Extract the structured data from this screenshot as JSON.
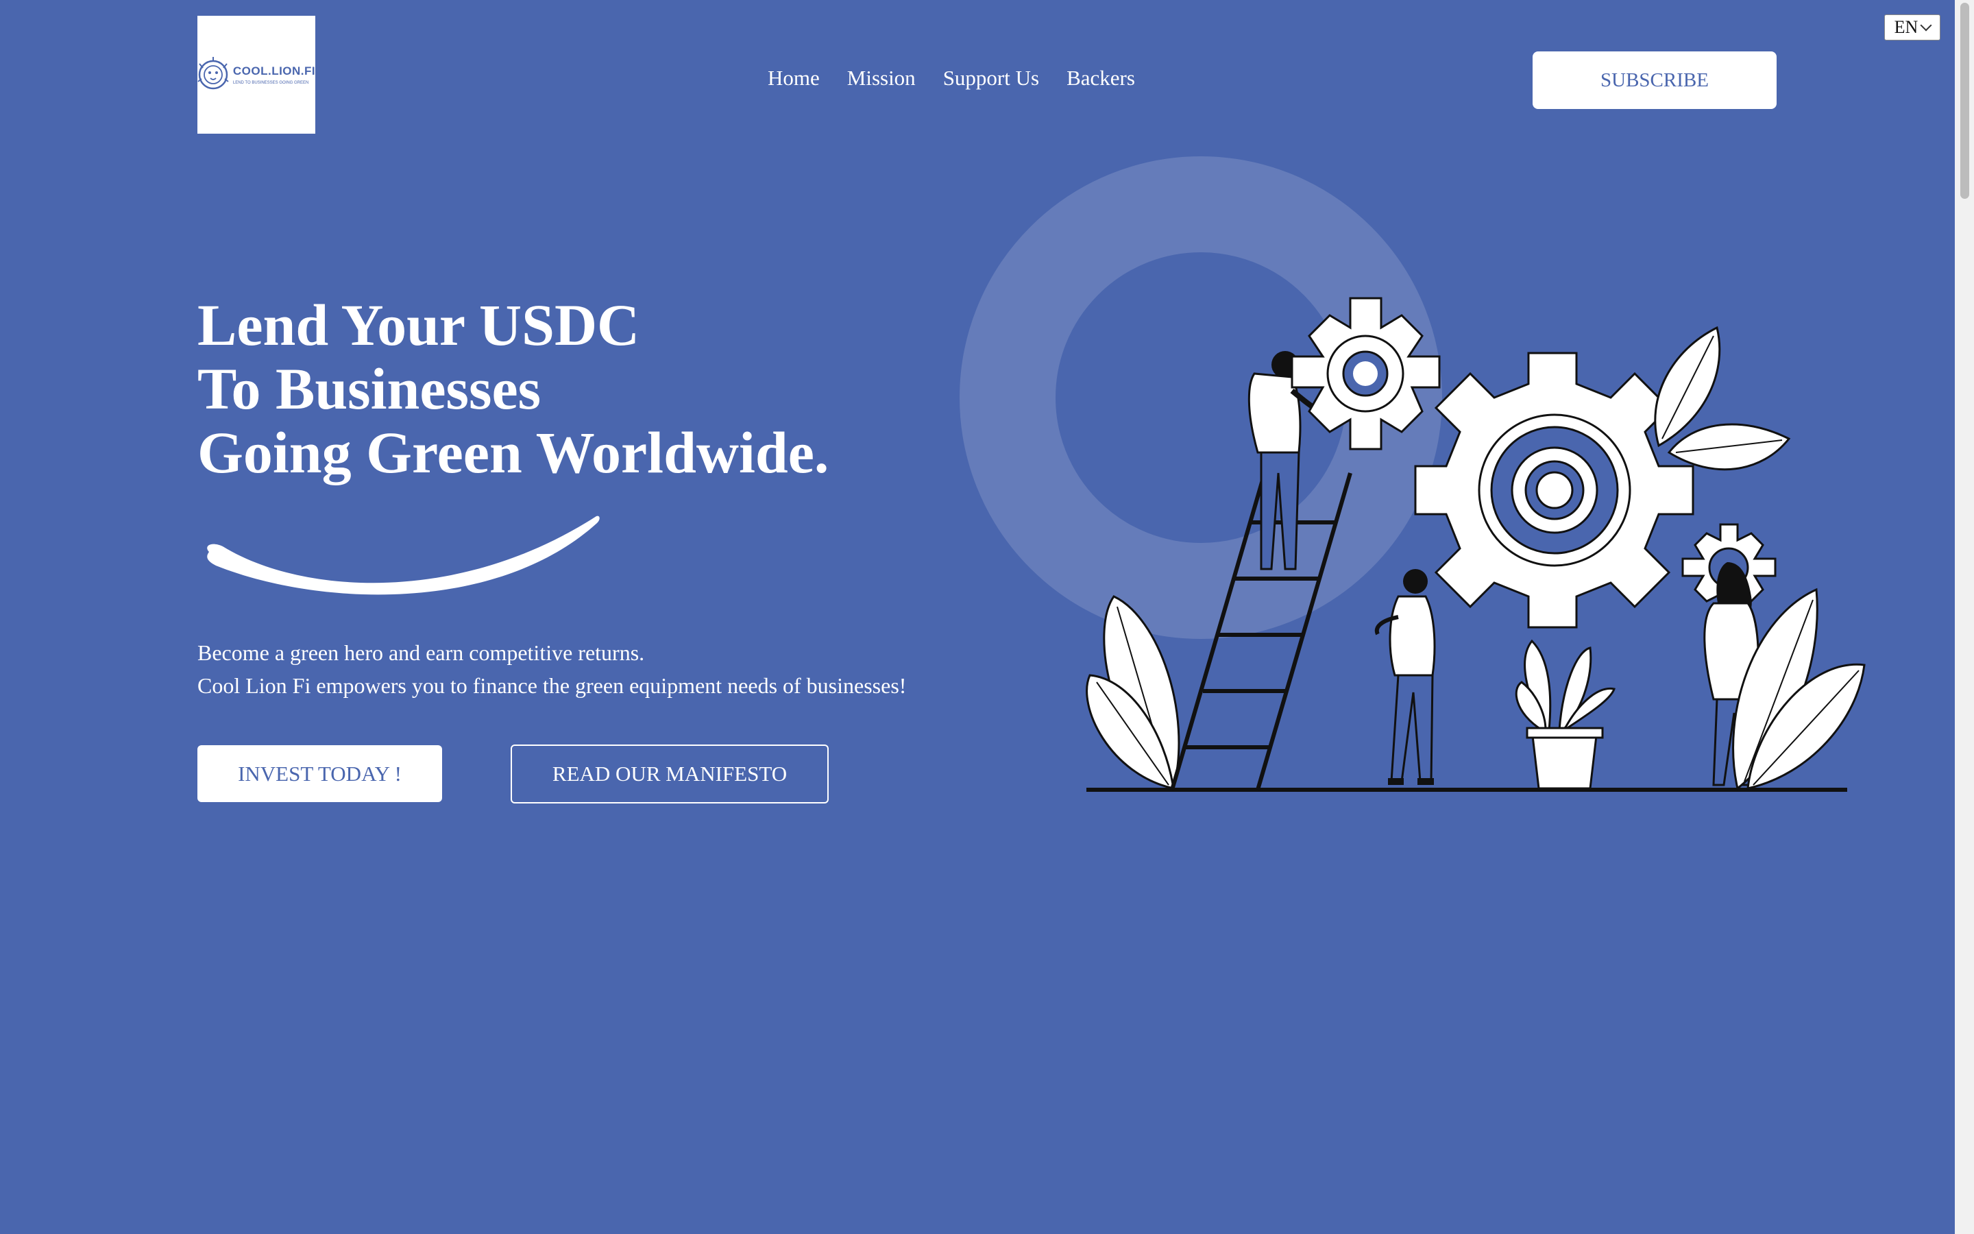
{
  "logo": {
    "name": "COOL.LION.FI",
    "tagline": "LEND TO BUSINESSES GOING GREEN"
  },
  "nav": {
    "items": [
      {
        "label": "Home"
      },
      {
        "label": "Mission"
      },
      {
        "label": "Support Us"
      },
      {
        "label": "Backers"
      }
    ],
    "subscribe_label": "SUBSCRIBE"
  },
  "language": {
    "selected": "EN"
  },
  "hero": {
    "title_lines": [
      "Lend Your USDC",
      "To Businesses",
      "Going Green Worldwide."
    ],
    "description_lines": [
      "Become a green hero and earn competitive returns.",
      "Cool Lion Fi empowers you to finance the green equipment needs of businesses!"
    ],
    "invest_label": "INVEST TODAY !",
    "manifesto_label": "READ OUR MANIFESTO"
  },
  "colors": {
    "background": "#4a66ae",
    "text": "#ffffff",
    "accent": "#4a66ae"
  },
  "icons": {
    "logo": "lion-head-icon",
    "language_dropdown": "chevron-down-icon",
    "illustration": "gears-teamwork-illustration"
  }
}
